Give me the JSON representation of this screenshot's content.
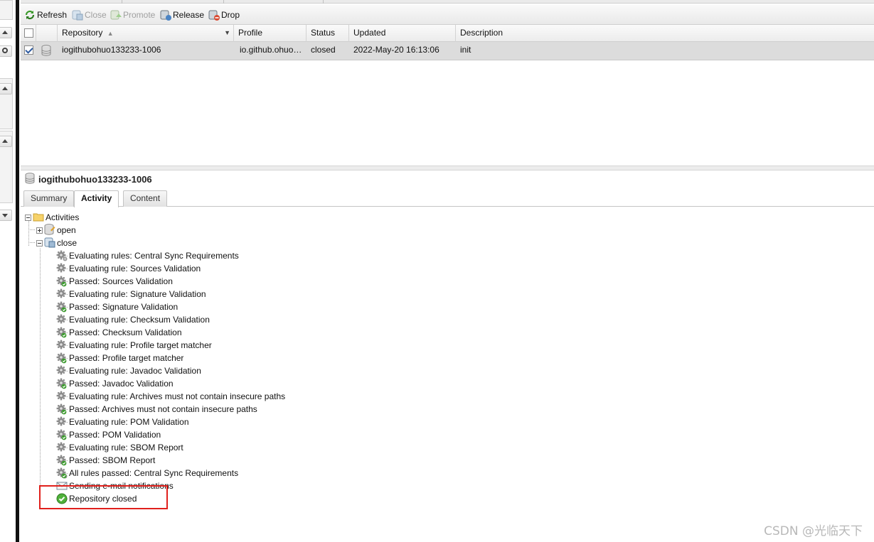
{
  "toolbar": {
    "refresh": "Refresh",
    "close": "Close",
    "promote": "Promote",
    "release": "Release",
    "drop": "Drop"
  },
  "grid": {
    "columns": [
      "Repository",
      "Profile",
      "Status",
      "Updated",
      "Description"
    ],
    "rows": [
      {
        "repository": "iogithubohuo133233-1006",
        "profile": "io.github.ohuo…",
        "status": "closed",
        "updated": "2022-May-20 16:13:06",
        "description": "init"
      }
    ]
  },
  "detail": {
    "title": "iogithubohuo133233-1006",
    "tabs": [
      "Summary",
      "Activity",
      "Content"
    ],
    "active_tab": "Activity"
  },
  "tree": {
    "root": "Activities",
    "open": "open",
    "close": "close",
    "events": [
      {
        "text": "Evaluating rules: Central Sync Requirements",
        "icon": "gears-icon"
      },
      {
        "text": "Evaluating rule: Sources Validation",
        "icon": "gear-icon"
      },
      {
        "text": "Passed: Sources Validation",
        "icon": "gear-passed-icon"
      },
      {
        "text": "Evaluating rule: Signature Validation",
        "icon": "gear-icon"
      },
      {
        "text": "Passed: Signature Validation",
        "icon": "gear-passed-icon"
      },
      {
        "text": "Evaluating rule: Checksum Validation",
        "icon": "gear-icon"
      },
      {
        "text": "Passed: Checksum Validation",
        "icon": "gear-passed-icon"
      },
      {
        "text": "Evaluating rule: Profile target matcher",
        "icon": "gear-icon"
      },
      {
        "text": "Passed: Profile target matcher",
        "icon": "gear-passed-icon"
      },
      {
        "text": "Evaluating rule: Javadoc Validation",
        "icon": "gear-icon"
      },
      {
        "text": "Passed: Javadoc Validation",
        "icon": "gear-passed-icon"
      },
      {
        "text": "Evaluating rule: Archives must not contain insecure paths",
        "icon": "gear-icon"
      },
      {
        "text": "Passed: Archives must not contain insecure paths",
        "icon": "gear-passed-icon"
      },
      {
        "text": "Evaluating rule: POM Validation",
        "icon": "gear-icon"
      },
      {
        "text": "Passed: POM Validation",
        "icon": "gear-passed-icon"
      },
      {
        "text": "Evaluating rule: SBOM Report",
        "icon": "gear-icon"
      },
      {
        "text": "Passed: SBOM Report",
        "icon": "gear-passed-icon"
      },
      {
        "text": "All rules passed: Central Sync Requirements",
        "icon": "gears-passed-icon"
      },
      {
        "text": "Sending e-mail notifications",
        "icon": "email-icon"
      },
      {
        "text": "Repository closed",
        "icon": "check-circle-icon"
      }
    ]
  },
  "watermark": "CSDN @光临天下"
}
